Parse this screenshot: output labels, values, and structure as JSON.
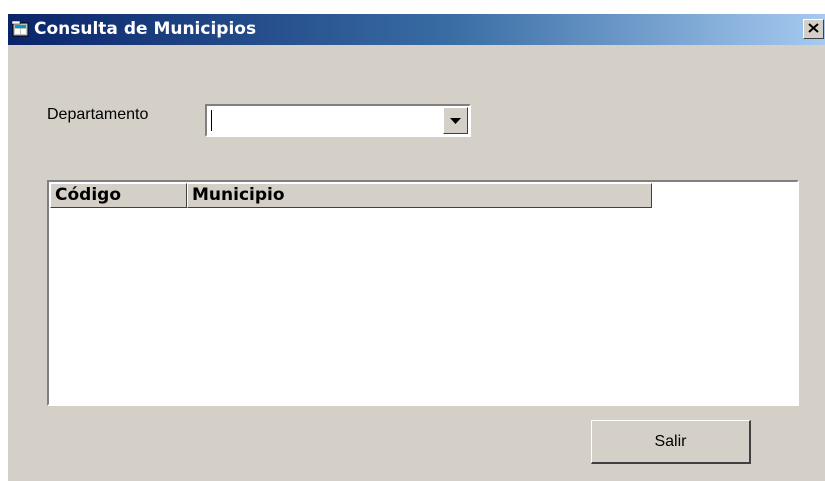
{
  "window": {
    "title": "Consulta de Municipios",
    "close_label": "×"
  },
  "form": {
    "departamento_label": "Departamento",
    "departamento_value": ""
  },
  "listview": {
    "columns": [
      "Código",
      "Municipio"
    ],
    "rows": []
  },
  "buttons": {
    "salir_label": "Salir"
  },
  "colors": {
    "titlebar_start": "#0a246a",
    "titlebar_end": "#a6caf0",
    "face": "#d4d0c8"
  }
}
